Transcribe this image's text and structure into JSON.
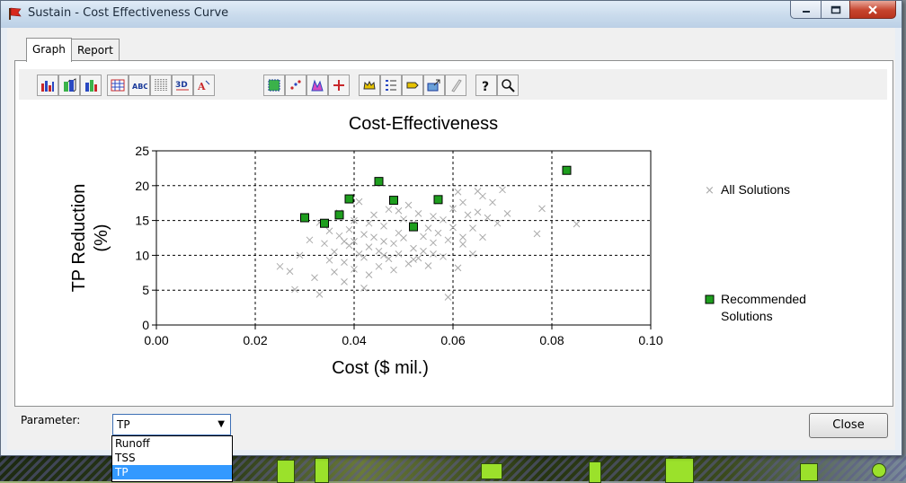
{
  "window": {
    "title": "Sustain - Cost Effectiveness Curve"
  },
  "tabs": [
    {
      "label": "Graph"
    },
    {
      "label": "Report"
    }
  ],
  "toolbar_icons": [
    "bar-chart-icon",
    "3d-bar-chart-icon",
    "stacked-bar-icon",
    "data-table-icon",
    "abc-text-icon",
    "grid-icon",
    "3d-view-icon",
    "font-icon",
    "select-region-icon",
    "scatter-icon",
    "color-chart-icon",
    "crosshair-icon",
    "crown-icon",
    "legend-icon",
    "tag-icon",
    "export-icon",
    "pen-icon",
    "help-icon",
    "zoom-icon"
  ],
  "footer": {
    "parameter_label": "Parameter:",
    "selected": "TP",
    "options": [
      "Runoff",
      "TSS",
      "TP"
    ],
    "close_label": "Close"
  },
  "colors": {
    "accent": "#3399ff",
    "recommended": "#1e9e1e",
    "all": "#aaaaaa"
  },
  "chart_data": {
    "type": "scatter",
    "title": "Cost-Effectiveness",
    "xlabel": "Cost ($ mil.)",
    "ylabel": "TP Reduction (%)",
    "xlim": [
      0.0,
      0.1
    ],
    "ylim": [
      0,
      25
    ],
    "xticks": [
      "0.00",
      "0.02",
      "0.04",
      "0.06",
      "0.08",
      "0.10"
    ],
    "yticks": [
      "0",
      "5",
      "10",
      "15",
      "20",
      "25"
    ],
    "grid": true,
    "legend_position": "right",
    "series": [
      {
        "name": "All Solutions",
        "marker": "x",
        "points": [
          [
            0.025,
            8.4
          ],
          [
            0.027,
            7.7
          ],
          [
            0.028,
            5.1
          ],
          [
            0.029,
            10.0
          ],
          [
            0.03,
            15.6
          ],
          [
            0.031,
            12.2
          ],
          [
            0.032,
            6.8
          ],
          [
            0.033,
            4.4
          ],
          [
            0.033,
            14.7
          ],
          [
            0.034,
            11.7
          ],
          [
            0.035,
            9.3
          ],
          [
            0.035,
            13.5
          ],
          [
            0.036,
            7.6
          ],
          [
            0.036,
            10.5
          ],
          [
            0.037,
            12.8
          ],
          [
            0.037,
            16.1
          ],
          [
            0.038,
            6.2
          ],
          [
            0.038,
            9.0
          ],
          [
            0.039,
            11.4
          ],
          [
            0.039,
            13.7
          ],
          [
            0.04,
            8.0
          ],
          [
            0.04,
            12.0
          ],
          [
            0.04,
            15.0
          ],
          [
            0.041,
            10.2
          ],
          [
            0.041,
            17.7
          ],
          [
            0.042,
            5.3
          ],
          [
            0.042,
            9.7
          ],
          [
            0.042,
            13.0
          ],
          [
            0.043,
            11.2
          ],
          [
            0.043,
            7.2
          ],
          [
            0.044,
            12.6
          ],
          [
            0.044,
            15.8
          ],
          [
            0.045,
            10.6
          ],
          [
            0.045,
            8.4
          ],
          [
            0.046,
            14.2
          ],
          [
            0.046,
            12.0
          ],
          [
            0.047,
            9.5
          ],
          [
            0.047,
            16.6
          ],
          [
            0.048,
            11.7
          ],
          [
            0.048,
            7.9
          ],
          [
            0.049,
            13.2
          ],
          [
            0.049,
            10.2
          ],
          [
            0.05,
            15.2
          ],
          [
            0.05,
            12.5
          ],
          [
            0.051,
            8.8
          ],
          [
            0.051,
            17.2
          ],
          [
            0.052,
            11.0
          ],
          [
            0.052,
            14.6
          ],
          [
            0.053,
            9.6
          ],
          [
            0.053,
            16.0
          ],
          [
            0.054,
            12.7
          ],
          [
            0.054,
            10.6
          ],
          [
            0.055,
            13.9
          ],
          [
            0.055,
            8.5
          ],
          [
            0.056,
            15.6
          ],
          [
            0.056,
            11.8
          ],
          [
            0.057,
            17.8
          ],
          [
            0.057,
            13.2
          ],
          [
            0.058,
            9.8
          ],
          [
            0.058,
            15.1
          ],
          [
            0.059,
            4.0
          ],
          [
            0.059,
            12.2
          ],
          [
            0.06,
            16.7
          ],
          [
            0.06,
            14.0
          ],
          [
            0.061,
            8.2
          ],
          [
            0.061,
            19.1
          ],
          [
            0.062,
            12.6
          ],
          [
            0.062,
            17.6
          ],
          [
            0.063,
            15.8
          ],
          [
            0.064,
            10.2
          ],
          [
            0.064,
            13.9
          ],
          [
            0.065,
            16.2
          ],
          [
            0.065,
            19.2
          ],
          [
            0.066,
            12.6
          ],
          [
            0.067,
            15.4
          ],
          [
            0.068,
            17.6
          ],
          [
            0.069,
            14.6
          ],
          [
            0.07,
            19.4
          ],
          [
            0.071,
            16.0
          ],
          [
            0.077,
            13.1
          ],
          [
            0.078,
            16.7
          ],
          [
            0.085,
            14.5
          ],
          [
            0.043,
            14.6
          ],
          [
            0.038,
            12.0
          ],
          [
            0.046,
            10.0
          ],
          [
            0.052,
            9.4
          ],
          [
            0.056,
            10.2
          ],
          [
            0.062,
            11.6
          ],
          [
            0.066,
            18.5
          ],
          [
            0.049,
            16.4
          ]
        ]
      },
      {
        "name": "Recommended Solutions",
        "marker": "square",
        "points": [
          [
            0.03,
            15.4
          ],
          [
            0.034,
            14.6
          ],
          [
            0.037,
            15.8
          ],
          [
            0.039,
            18.1
          ],
          [
            0.045,
            20.6
          ],
          [
            0.048,
            17.9
          ],
          [
            0.052,
            14.1
          ],
          [
            0.057,
            18.0
          ],
          [
            0.083,
            22.2
          ]
        ]
      }
    ]
  }
}
